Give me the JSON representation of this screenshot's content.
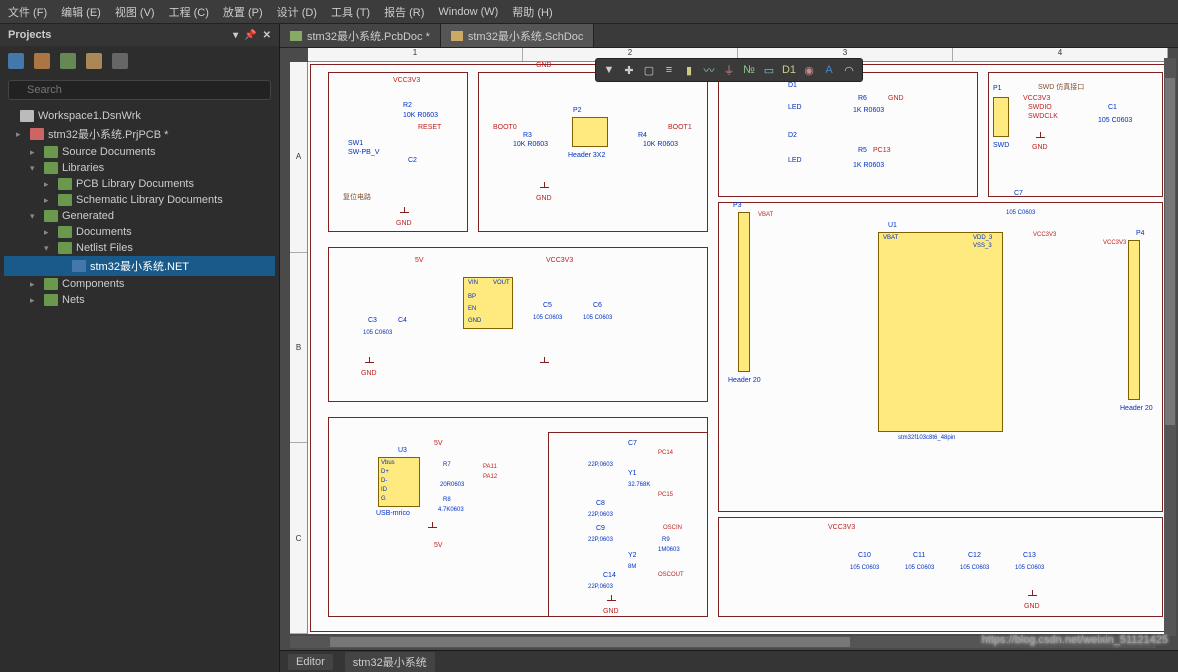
{
  "menu": [
    "文件 (F)",
    "编辑 (E)",
    "视图 (V)",
    "工程 (C)",
    "放置 (P)",
    "设计 (D)",
    "工具 (T)",
    "报告 (R)",
    "Window (W)",
    "帮助 (H)"
  ],
  "panel": {
    "title": "Projects",
    "search_ph": "Search"
  },
  "tree": {
    "wrk": "Workspace1.DsnWrk",
    "proj": "stm32最小系统.PrjPCB *",
    "src": "Source Documents",
    "lib": "Libraries",
    "pcblib": "PCB Library Documents",
    "schlib": "Schematic Library Documents",
    "gen": "Generated",
    "docs": "Documents",
    "netf": "Netlist Files",
    "netfile": "stm32最小系统.NET",
    "comp": "Components",
    "nets": "Nets"
  },
  "tabs": {
    "t1": "stm32最小系统.PcbDoc *",
    "t2": "stm32最小系统.SchDoc"
  },
  "ruler_h": [
    "1",
    "2",
    "3",
    "4"
  ],
  "ruler_v": [
    "A",
    "B",
    "C"
  ],
  "sch": {
    "vcc3v3": "VCC3V3",
    "vcc5v": "5V",
    "gnd": "GND",
    "reset_title": "复位电路",
    "swd_title": "SWD 仿真接口",
    "r2": "R2",
    "r2v": "10K R0603",
    "reset": "RESET",
    "c2": "C2",
    "sw1": "SW1",
    "swpb": "SW-PB_V",
    "boot0": "BOOT0",
    "boot1": "BOOT1",
    "r3": "R3",
    "r4": "R4",
    "r3v": "10K R0603",
    "r4v": "10K R0603",
    "p2": "P2",
    "hdr3x2": "Header 3X2",
    "d1": "D1",
    "d2": "D2",
    "led": "LED",
    "r6": "R6",
    "r5": "R5",
    "r6v": "1K R0603",
    "r5v": "1K R0603",
    "pc13": "PC13",
    "p1": "P1",
    "swd": "SWD",
    "swdio": "SWDIO",
    "swdclk": "SWDCLK",
    "c1": "C1",
    "c1v": "105 C0603",
    "vin": "VIN",
    "vout": "VOUT",
    "bp": "BP",
    "en": "EN",
    "gndp": "GND",
    "c3": "C3",
    "c4": "C4",
    "c5": "C5",
    "c6": "C6",
    "capsv": "105 C0603",
    "p3": "P3",
    "hdr20": "Header 20",
    "p4": "P4",
    "u1": "U1",
    "u1name": "stm32f103c8t6_48pin",
    "vbat": "VBAT",
    "vdd3": "VDD_3",
    "vss3": "VSS_3",
    "u3": "U3",
    "usb": "USB-mrico",
    "vbus": "Vbus",
    "dp": "D+",
    "dm": "D-",
    "id": "ID",
    "g": "G",
    "r7": "R7",
    "r8": "R8",
    "r7v": "20R0603",
    "r8v": "4.7K0603",
    "pa11": "PA11",
    "pa12": "PA12",
    "c7": "C7",
    "c8": "C8",
    "c9": "C9",
    "c14": "C14",
    "c7v": "22P,0603",
    "c8v": "22P,0603",
    "c9v": "22P,0603",
    "c14v": "22P,0603",
    "y1": "Y1",
    "y1v": "32.768K",
    "y2": "Y2",
    "y2v": "8M",
    "r9": "R9",
    "r9v": "1M0603",
    "pc14": "PC14",
    "pc15": "PC15",
    "oscin": "OSCIN",
    "oscout": "OSCOUT",
    "c10": "C10",
    "c11": "C11",
    "c12": "C12",
    "c13": "C13",
    "c10v": "105 C0603"
  },
  "status": {
    "editor": "Editor",
    "name": "stm32最小系统"
  },
  "watermark": "https://blog.csdn.net/weixin_51121425"
}
